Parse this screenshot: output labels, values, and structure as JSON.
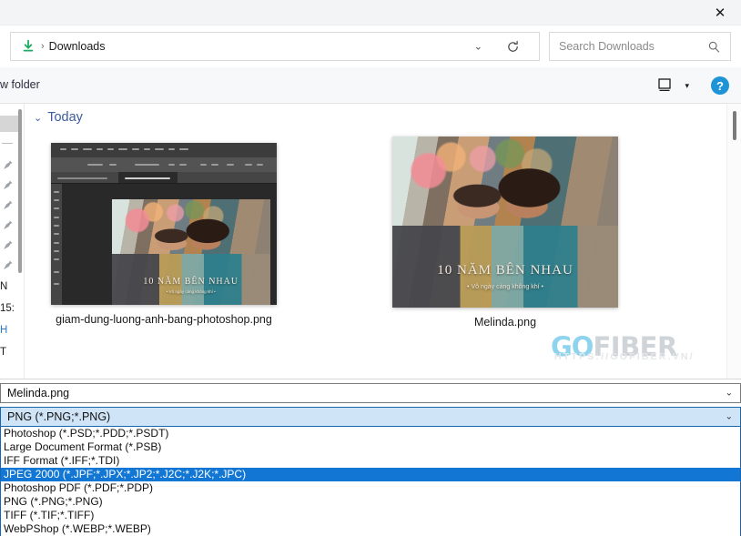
{
  "titlebar": {
    "close_label": "✕",
    "close_icon": "close-icon"
  },
  "nav": {
    "breadcrumb_icon": "downloads-arrow-icon",
    "breadcrumb_separator": "›",
    "breadcrumb_text": "Downloads",
    "chevron": "⌄",
    "refresh_icon": "refresh-icon",
    "search_placeholder": "Search Downloads",
    "search_value": "",
    "search_icon": "search-icon"
  },
  "toolbar": {
    "new_folder_label": "w folder",
    "view_icon": "monitor-view-icon",
    "view_caret": "▾",
    "help_label": "?",
    "help_icon": "help-icon"
  },
  "sidebar": {
    "scrollbar": "sidebar-scrollbar",
    "items": [
      {
        "label": "",
        "icon": "selected-item-highlight"
      },
      {
        "label": "",
        "icon": "divider"
      },
      {
        "label": "",
        "icon": "pin-icon"
      },
      {
        "label": "",
        "icon": "pin-icon"
      },
      {
        "label": "",
        "icon": "pin-icon"
      },
      {
        "label": "",
        "icon": "pin-icon"
      },
      {
        "label": "",
        "icon": "pin-icon"
      },
      {
        "label": "",
        "icon": "pin-icon"
      },
      {
        "label": "N",
        "icon": ""
      },
      {
        "label": "15:",
        "icon": ""
      },
      {
        "label": "H",
        "icon": ""
      },
      {
        "label": "T",
        "icon": ""
      }
    ]
  },
  "content": {
    "group_caret": "⌄",
    "group_title": "Today",
    "files": [
      {
        "name": "giam-dung-luong-anh-bang-photoshop.png",
        "kind": "photoshop-screenshot",
        "overlay_title": "10 NĂM BÊN NHAU",
        "overlay_subtitle": "• Vô ngày càng không khí •"
      },
      {
        "name": "Melinda.png",
        "kind": "photo",
        "overlay_title": "10 NĂM BÊN NHAU",
        "overlay_subtitle": "• Vô ngày càng không khí •"
      }
    ]
  },
  "watermark": {
    "go": "GO",
    "fiber": "FIBER",
    "url": "HTTPS://GOFIBER.VN/"
  },
  "form": {
    "filename_label": "file-name-field",
    "filename_value": "Melinda.png",
    "filename_chevron": "⌄",
    "format_value": "PNG (*.PNG;*.PNG)",
    "format_chevron": "⌄",
    "format_options": [
      "Photoshop (*.PSD;*.PDD;*.PSDT)",
      "Large Document Format (*.PSB)",
      "IFF Format (*.IFF;*.TDI)",
      "JPEG 2000 (*.JPF;*.JPX;*.JP2;*.J2C;*.J2K;*.JPC)",
      "Photoshop PDF (*.PDF;*.PDP)",
      "PNG (*.PNG;*.PNG)",
      "TIFF (*.TIF;*.TIFF)",
      "WebPShop (*.WEBP;*.WEBP)"
    ],
    "selected_option_index": 3
  },
  "colors": {
    "accent_blue": "#1277d4",
    "combo_highlight": "#cfe4f7",
    "group_title": "#3c5c9c",
    "help_blue": "#1e94d7",
    "download_green": "#1fab62"
  }
}
